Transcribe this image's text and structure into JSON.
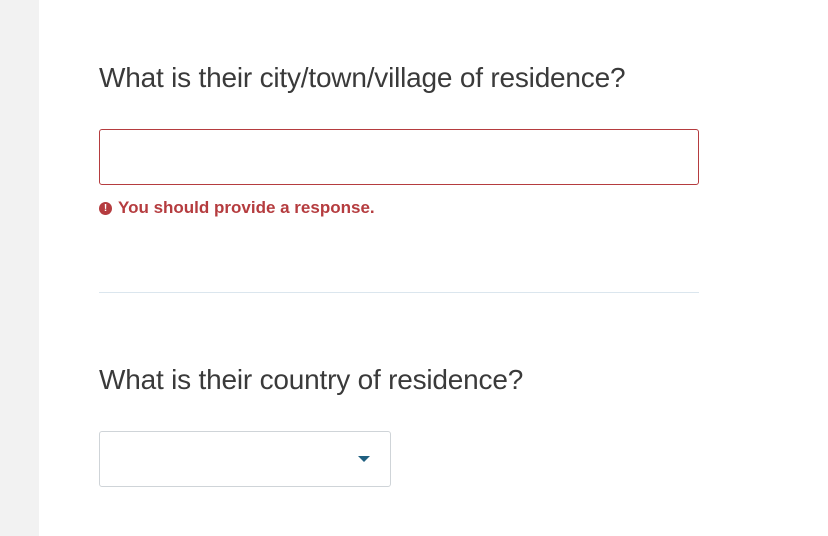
{
  "form": {
    "city_question": "What is their city/town/village of residence?",
    "city_input": {
      "value": "",
      "placeholder": ""
    },
    "city_error": "You should provide a response.",
    "country_question": "What is their country of residence?",
    "country_select": {
      "selected": ""
    }
  },
  "icons": {
    "error": "exclamation-circle-icon",
    "dropdown": "caret-down-icon"
  },
  "colors": {
    "error": "#b53c3f",
    "text": "#3a3a3a",
    "caret": "#1f5f80",
    "divider": "#dbe6ee",
    "gutter": "#f2f2f2"
  }
}
